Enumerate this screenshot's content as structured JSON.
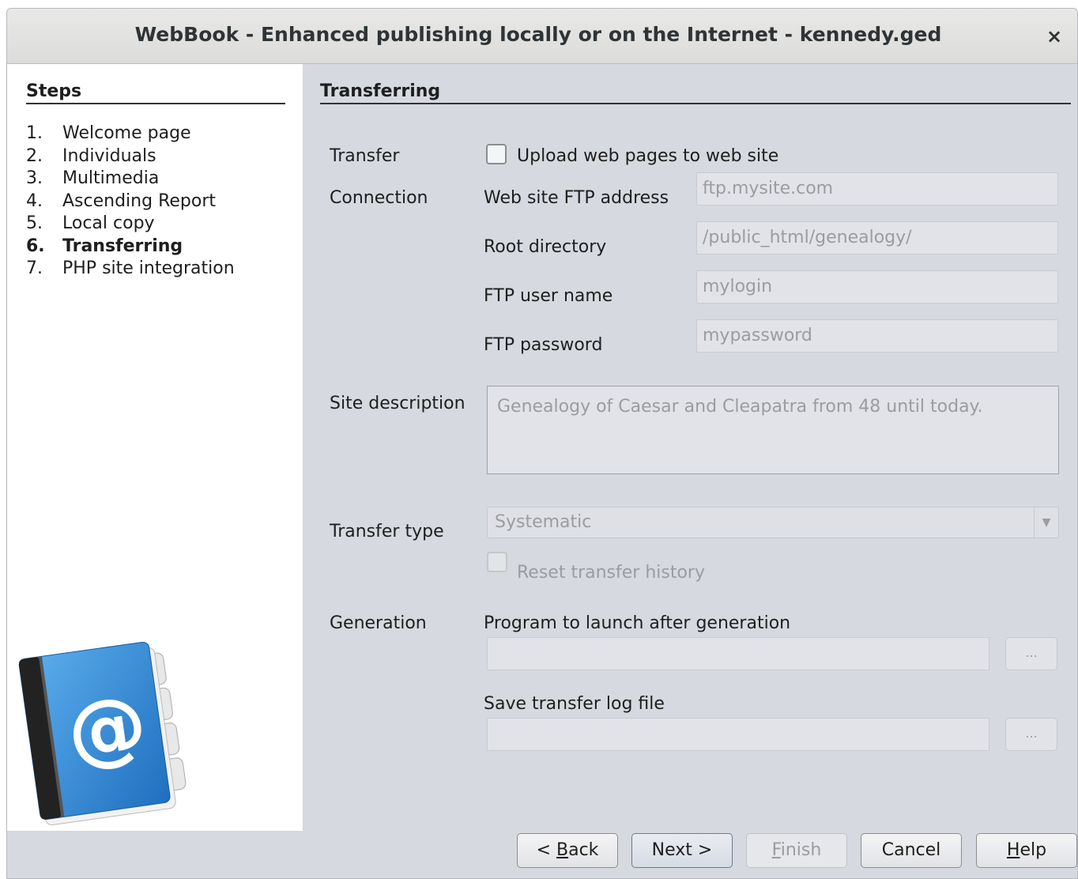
{
  "window": {
    "title": "WebBook - Enhanced publishing locally or on the Internet - kennedy.ged",
    "close_glyph": "×"
  },
  "sidebar": {
    "title": "Steps",
    "steps": [
      {
        "num": "1.",
        "label": "Welcome page"
      },
      {
        "num": "2.",
        "label": "Individuals"
      },
      {
        "num": "3.",
        "label": "Multimedia"
      },
      {
        "num": "4.",
        "label": "Ascending Report"
      },
      {
        "num": "5.",
        "label": "Local copy"
      },
      {
        "num": "6.",
        "label": "Transferring"
      },
      {
        "num": "7.",
        "label": "PHP site integration"
      }
    ],
    "active_step": 6,
    "logo_icon": "address-book-at-icon"
  },
  "main": {
    "title": "Transferring",
    "transfer": {
      "label": "Transfer",
      "upload_label": "Upload web pages to web site",
      "upload_checked": false
    },
    "connection": {
      "label": "Connection",
      "ftp_address_label": "Web site FTP address",
      "ftp_address_value": "ftp.mysite.com",
      "root_dir_label": "Root directory",
      "root_dir_value": "/public_html/genealogy/",
      "user_label": "FTP user name",
      "user_value": "mylogin",
      "password_label": "FTP password",
      "password_value": "mypassword"
    },
    "site_description": {
      "label": "Site description",
      "value": "Genealogy of Caesar and Cleapatra from 48 until today."
    },
    "transfer_type": {
      "label": "Transfer type",
      "selected": "Systematic",
      "reset_label": "Reset transfer history"
    },
    "generation": {
      "label": "Generation",
      "program_label": "Program to launch after generation",
      "program_value": "",
      "log_label": "Save transfer log file",
      "log_value": "",
      "browse_label": "..."
    }
  },
  "buttons": {
    "back_prefix": "< ",
    "back_mnemonic": "B",
    "back_rest": "ack",
    "next": "Next >",
    "finish_mnemonic": "F",
    "finish_rest": "inish",
    "cancel": "Cancel",
    "help_mnemonic": "H",
    "help_rest": "elp"
  }
}
